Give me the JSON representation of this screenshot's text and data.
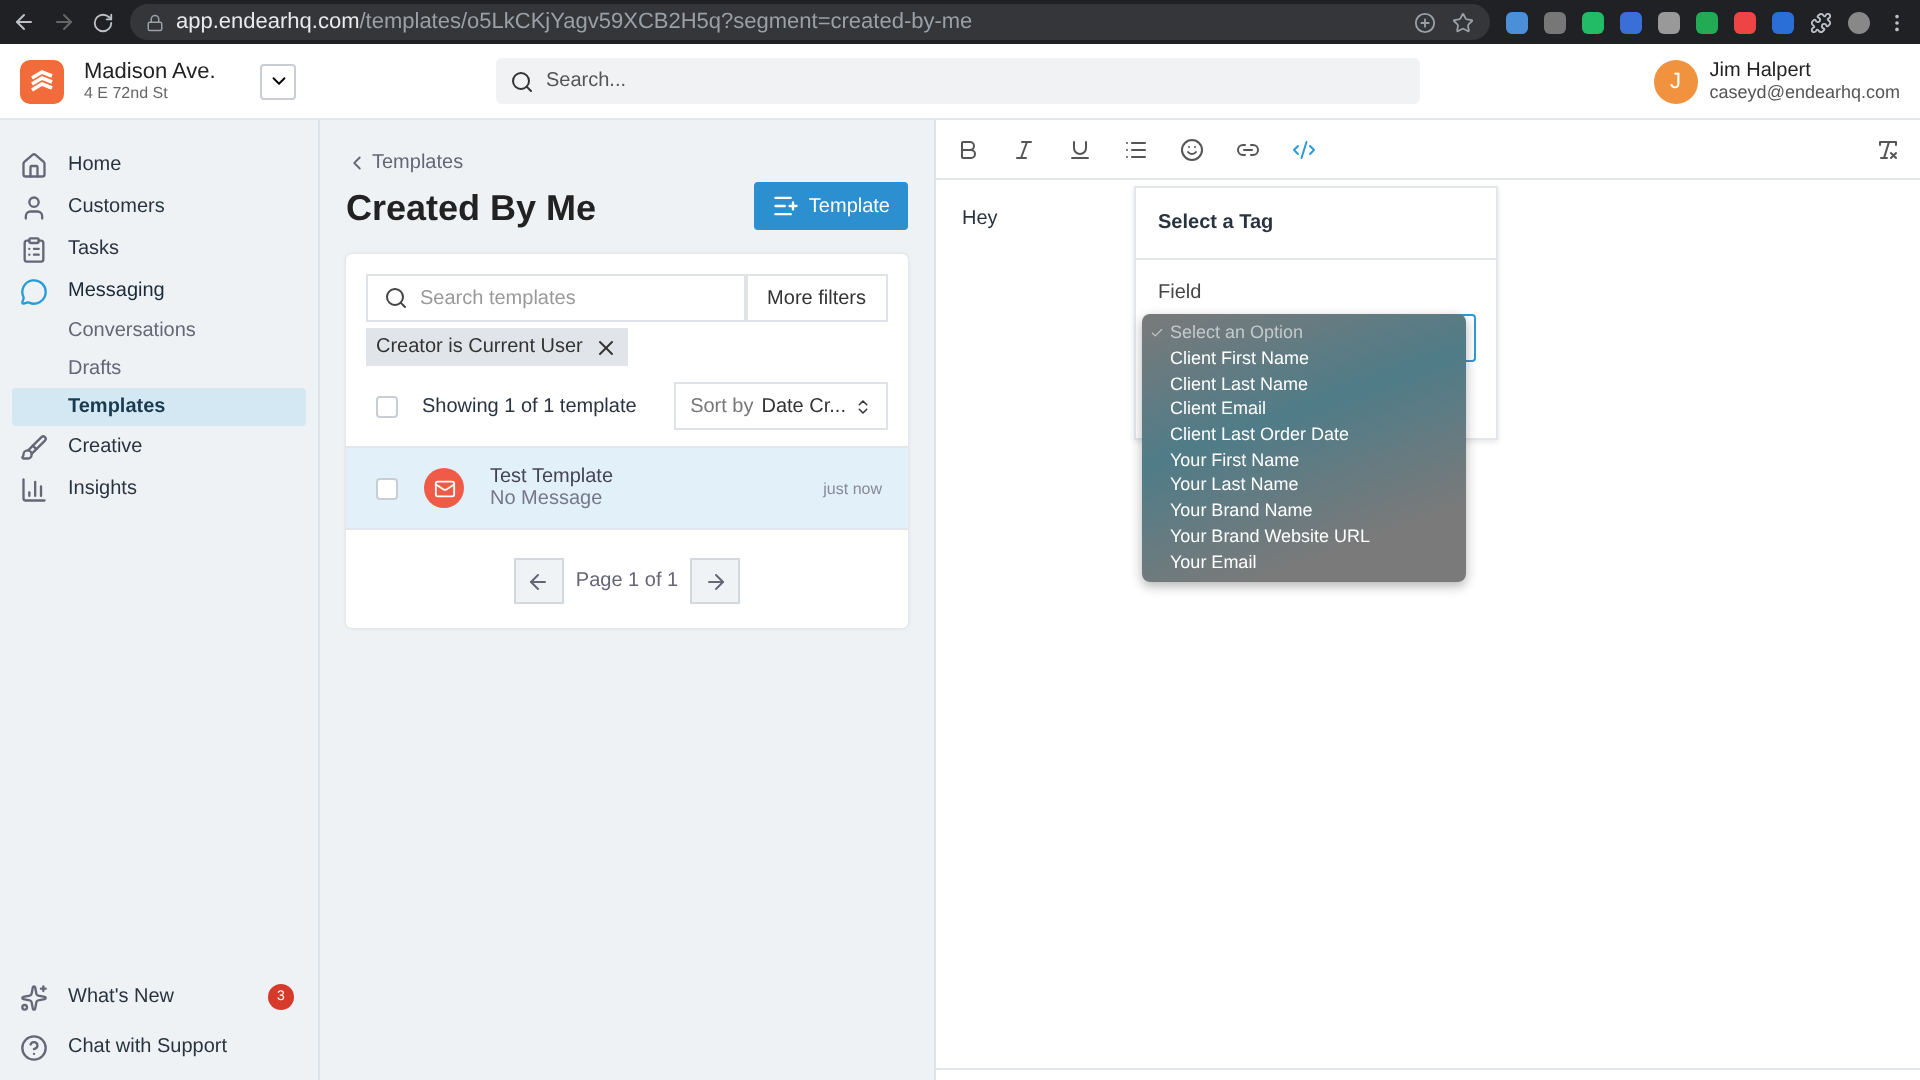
{
  "browser": {
    "url_host": "app.endearhq.com",
    "url_path": "/templates/o5LkCKjYagv59XCB2H5q?segment=created-by-me"
  },
  "header": {
    "location_name": "Madison Ave.",
    "location_address": "4 E 72nd St",
    "search_placeholder": "Search...",
    "user_initial": "J",
    "user_name": "Jim Halpert",
    "user_email": "caseyd@endearhq.com"
  },
  "sidebar": {
    "items": [
      {
        "kind": "home",
        "label": "Home",
        "selected": false
      },
      {
        "kind": "customers",
        "label": "Customers",
        "selected": false
      },
      {
        "kind": "tasks",
        "label": "Tasks",
        "selected": false
      },
      {
        "kind": "messaging",
        "label": "Messaging",
        "selected": true,
        "children": [
          {
            "label": "Conversations",
            "selected": false
          },
          {
            "label": "Drafts",
            "selected": false
          },
          {
            "label": "Templates",
            "selected": true
          }
        ]
      },
      {
        "kind": "creative",
        "label": "Creative",
        "selected": false
      },
      {
        "kind": "insights",
        "label": "Insights",
        "selected": false
      }
    ],
    "footer": [
      {
        "kind": "news",
        "label": "What's New",
        "badge": "3"
      },
      {
        "kind": "help",
        "label": "Chat with Support"
      }
    ]
  },
  "templates": {
    "back_link": "Templates",
    "title": "Created By Me",
    "new_button": "Template",
    "search_placeholder": "Search templates",
    "filters_button": "More filters",
    "filter_chip": "Creator is Current User",
    "select_all_checked": false,
    "showing": "Showing 1 of 1 template",
    "sort_prefix": "Sort by",
    "sort_value": "Date Cr...",
    "rows": [
      {
        "title": "Test Template",
        "subtitle": "No Message",
        "time": "just now",
        "selected": true,
        "checked": false
      }
    ],
    "page_label": "Page 1 of 1"
  },
  "editor": {
    "toolbar": [
      {
        "kind": "bold",
        "active": false
      },
      {
        "kind": "italic",
        "active": false
      },
      {
        "kind": "underline",
        "active": false
      },
      {
        "kind": "list",
        "active": false
      },
      {
        "kind": "emoji",
        "active": false
      },
      {
        "kind": "link",
        "active": false
      },
      {
        "kind": "tag",
        "active": true
      },
      {
        "kind": "clear",
        "active": false
      }
    ],
    "body": "Hey",
    "tag_popover": {
      "title": "Select a Tag",
      "field_label": "Field",
      "options": [
        {
          "label": "Select an Option",
          "selected": true
        },
        {
          "label": "Client First Name",
          "selected": false
        },
        {
          "label": "Client Last Name",
          "selected": false
        },
        {
          "label": "Client Email",
          "selected": false
        },
        {
          "label": "Client Last Order Date",
          "selected": false
        },
        {
          "label": "Your First Name",
          "selected": false
        },
        {
          "label": "Your Last Name",
          "selected": false
        },
        {
          "label": "Your Brand Name",
          "selected": false
        },
        {
          "label": "Your Brand Website URL",
          "selected": false
        },
        {
          "label": "Your Email",
          "selected": false
        }
      ]
    }
  }
}
